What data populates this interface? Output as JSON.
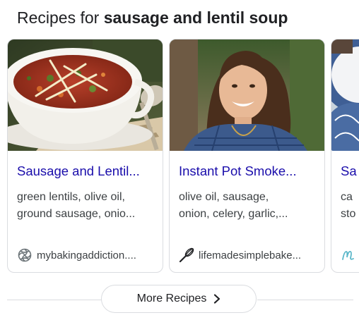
{
  "heading": {
    "prefix": "Recipes for ",
    "query": "sausage and lentil soup"
  },
  "recipes": [
    {
      "title": "Sausage and Lentil...",
      "ingredients_line1": "green lentils, olive oil,",
      "ingredients_line2": "ground sausage, onio...",
      "source": "mybakingaddiction....",
      "source_icon": "spiral-logo-icon"
    },
    {
      "title": "Instant Pot Smoke...",
      "ingredients_line1": "olive oil, sausage,",
      "ingredients_line2": "onion, celery, garlic,...",
      "source": "lifemadesimplebake...",
      "source_icon": "whisk-icon"
    },
    {
      "title": "Sa",
      "ingredients_line1": "ca",
      "ingredients_line2": "sto",
      "source": "",
      "source_icon": "script-m-logo-icon"
    }
  ],
  "more_button": {
    "label": "More Recipes",
    "icon": "chevron-right-icon"
  },
  "colors": {
    "title_link": "#1a0dab",
    "text": "#3c4043",
    "border": "#dadce0"
  }
}
